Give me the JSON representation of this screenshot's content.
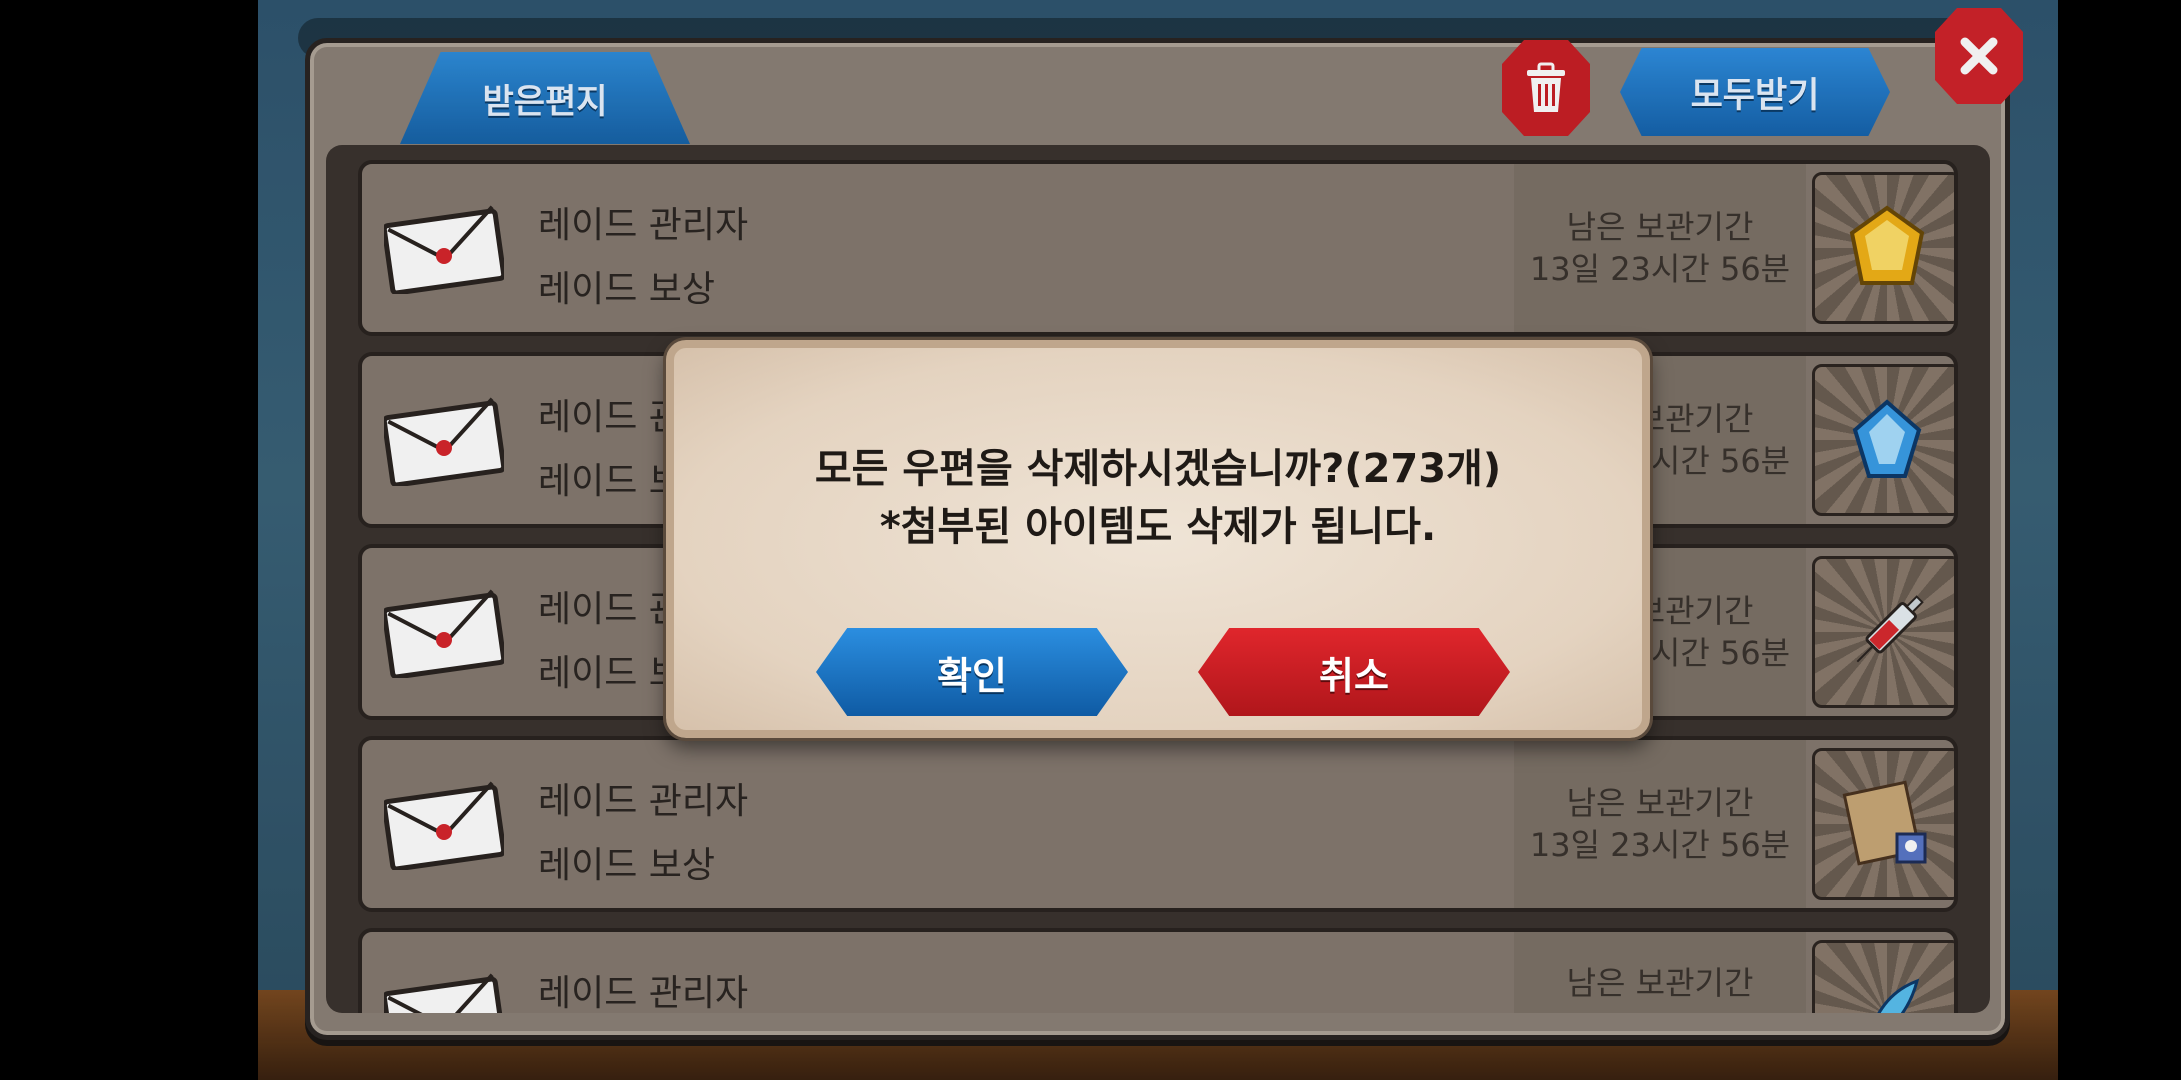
{
  "mailbox": {
    "tab_label": "받은편지",
    "receive_all_label": "모두받기",
    "mails": [
      {
        "sender": "레이드 관리자",
        "subject": "레이드 보상",
        "expiry_label": "남은 보관기간",
        "expiry_time": "13일 23시간 56분",
        "item_icon": "gold-gem-icon"
      },
      {
        "sender": "레이드 관리자",
        "subject": "레이드 보상",
        "expiry_label": "남은 보관기간",
        "expiry_time": "13일 23시간 56분",
        "item_icon": "blue-crystal-icon"
      },
      {
        "sender": "레이드 관리자",
        "subject": "레이드 보상",
        "expiry_label": "남은 보관기간",
        "expiry_time": "13일 23시간 56분",
        "item_icon": "syringe-icon"
      },
      {
        "sender": "레이드 관리자",
        "subject": "레이드 보상",
        "expiry_label": "남은 보관기간",
        "expiry_time": "13일 23시간 56분",
        "item_icon": "map-scroll-icon"
      },
      {
        "sender": "레이드 관리자",
        "subject": "",
        "expiry_label": "남은 보관기간",
        "expiry_time": "",
        "item_icon": "blue-feather-icon"
      }
    ]
  },
  "dialog": {
    "line1": "모든 우편을 삭제하시겠습니까?(273개)",
    "line2": "*첨부된 아이템도 삭제가 됩니다.",
    "confirm_label": "확인",
    "cancel_label": "취소"
  },
  "colors": {
    "accent_blue": "#1d72c4",
    "accent_red": "#cc1e24",
    "panel": "#8c8178"
  }
}
